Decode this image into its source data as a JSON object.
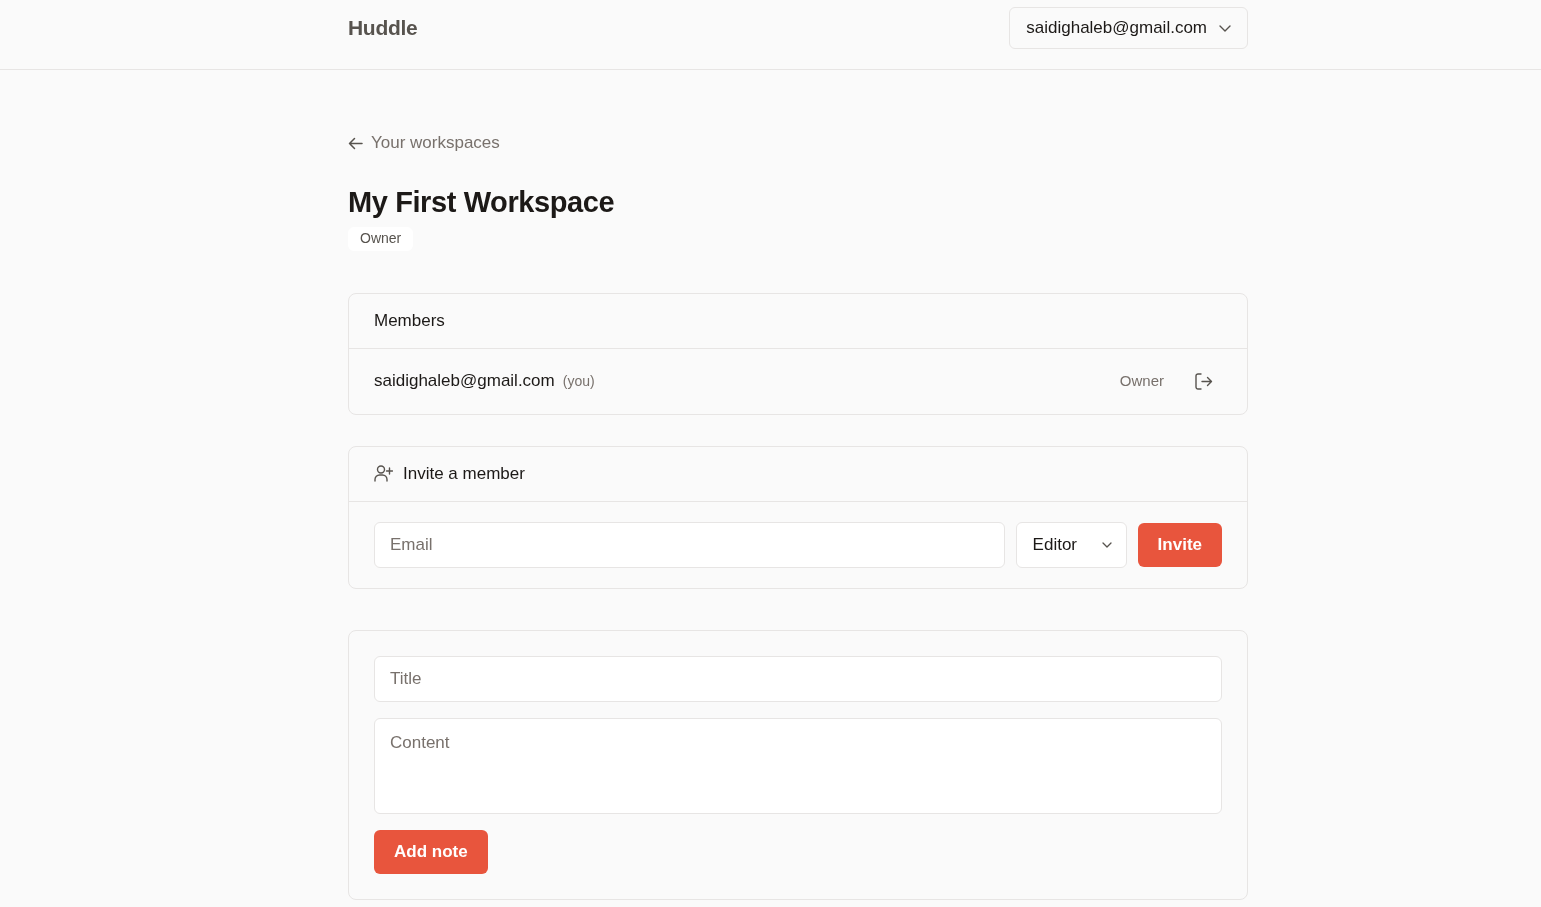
{
  "header": {
    "brand": "Huddle",
    "account_menu": {
      "label": "saidighaleb@gmail.com"
    }
  },
  "back_link": {
    "label": "Your workspaces"
  },
  "workspace": {
    "title": "My First Workspace",
    "role_badge": "Owner"
  },
  "members_card": {
    "title": "Members",
    "members": [
      {
        "email": "saidighaleb@gmail.com",
        "you_label": "(you)",
        "role": "Owner"
      }
    ]
  },
  "invite_card": {
    "title": "Invite a member",
    "email_field": {
      "placeholder": "Email"
    },
    "role_select": {
      "value": "Editor"
    },
    "button": "Invite"
  },
  "note_form": {
    "title_field": {
      "placeholder": "Title"
    },
    "content_field": {
      "placeholder": "Content"
    },
    "button": "Add note"
  }
}
